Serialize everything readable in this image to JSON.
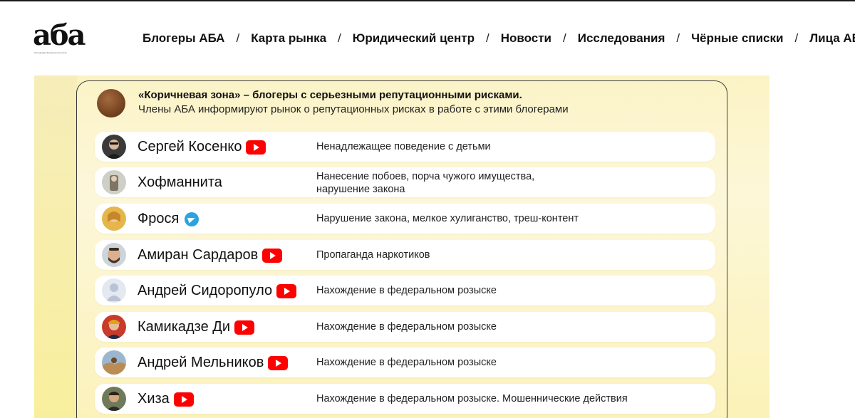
{
  "logo": {
    "text": "аба",
    "subtitle": "Ассоциация блогеров и агентств"
  },
  "nav": {
    "items": [
      "Блогеры АБА",
      "Карта рынка",
      "Юридический центр",
      "Новости",
      "Исследования",
      "Чёрные списки",
      "Лица АБА"
    ],
    "separator": "/"
  },
  "zone": {
    "title": "«Коричневая зона» – блогеры с серьезными репутационными рисками.",
    "subtitle": "Члены АБА информируют рынок о репутационных рисках в работе с этими блогерами",
    "color": "#7a4524"
  },
  "bloggers": [
    {
      "name": "Сергей Косенко",
      "platform": "youtube-icon",
      "reason": "Ненадлежащее поведение с детьми",
      "reason2": ""
    },
    {
      "name": "Хофманнита",
      "platform": "",
      "reason": "Нанесение побоев, порча чужого имущества,",
      "reason2": "нарушение закона"
    },
    {
      "name": "Фрося",
      "platform": "telegram-icon",
      "reason": "Нарушение закона, мелкое хулиганство, треш-контент",
      "reason2": ""
    },
    {
      "name": "Амиран Сардаров",
      "platform": "youtube-icon",
      "reason": "Пропаганда наркотиков",
      "reason2": ""
    },
    {
      "name": "Андрей Сидоропуло",
      "platform": "youtube-icon",
      "reason": "Нахождение в федеральном розыске",
      "reason2": ""
    },
    {
      "name": "Камикадзе Ди",
      "platform": "youtube-icon",
      "reason": "Нахождение в федеральном розыске",
      "reason2": ""
    },
    {
      "name": "Андрей Мельников",
      "platform": "youtube-icon",
      "reason": "Нахождение в федеральном розыске",
      "reason2": ""
    },
    {
      "name": "Хиза",
      "platform": "youtube-icon",
      "reason": "Нахождение в федеральном розыске. Мошеннические действия",
      "reason2": ""
    }
  ],
  "colors": {
    "youtube": "#ff0000",
    "telegram": "#2aa3df",
    "panel": "#fbf3c4"
  }
}
